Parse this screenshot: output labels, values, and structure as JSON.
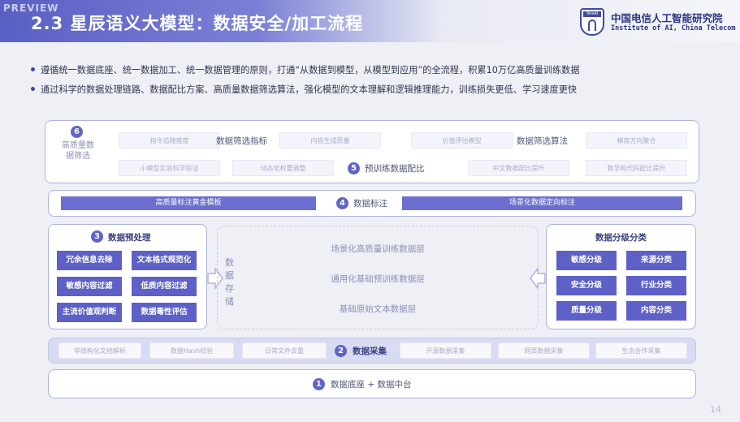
{
  "header": {
    "preview_tag": "PREVIEW",
    "title": "2.3 星辰语义大模型：数据安全/加工流程",
    "org_cn": "中国电信人工智能研究院",
    "org_en": "Institute of AI, China Telecom",
    "logo_text": "TeleAI"
  },
  "bullets": [
    "遵循统一数据底座、统一数据加工、统一数据管理的原则，打通“从数据到模型，从模型到应用”的全流程，积累10万亿高质量训练数据",
    "通过科学的数据处理链路、数据配比方案、高质量数据筛选算法，强化模型的文本理解和逻辑推理能力，训练损失更低、学习速度更快"
  ],
  "stage6": {
    "number": "6",
    "title": "高质量数据筛选",
    "metric_label": "数据筛选指标",
    "algo_label": "数据筛选算法",
    "metric_items": [
      "指令追随难度",
      "内容生成质量"
    ],
    "algo_items": [
      "价值评估模型",
      "梯度方向聚合"
    ]
  },
  "stage5": {
    "number": "5",
    "title": "预训练数据配比",
    "left_items": [
      "小模型实验科学验证",
      "动态化权重调整"
    ],
    "right_items": [
      "中文数据配比提升",
      "数学和代码配比提升"
    ]
  },
  "stage4": {
    "number": "4",
    "title": "数据标注",
    "left_bar": "高质量标注黄金模板",
    "right_bar": "场景化数据定向标注"
  },
  "stage3": {
    "number": "3",
    "title": "数据预处理",
    "tiles": [
      "冗余信息去除",
      "文本格式规范化",
      "敏感内容过滤",
      "低质内容过滤",
      "主流价值观判断",
      "数据毒性评估"
    ]
  },
  "storage": {
    "label": "数据存储",
    "layers": [
      "场景化高质量训练数据层",
      "通用化基础预训练数据层",
      "基础原始文本数据层"
    ]
  },
  "classification": {
    "title": "数据分级分类",
    "tiles": [
      "敏感分级",
      "来源分类",
      "安全分级",
      "行业分类",
      "质量分级",
      "内容分类"
    ]
  },
  "stage2": {
    "number": "2",
    "title": "数据采集",
    "left_items": [
      "非结构化文档解析",
      "数据Hash校验",
      "日常文件去重"
    ],
    "right_items": [
      "开源数据采集",
      "网页数据采集",
      "生态合作采集"
    ]
  },
  "stage1": {
    "number": "1",
    "title": "数据底座 + 数据中台"
  },
  "page_number": "14",
  "colors": {
    "accent": "#5d60c6",
    "border": "#aeb3e0",
    "title_bar_start": "#5a5fc4",
    "org_text": "#2b3583"
  }
}
